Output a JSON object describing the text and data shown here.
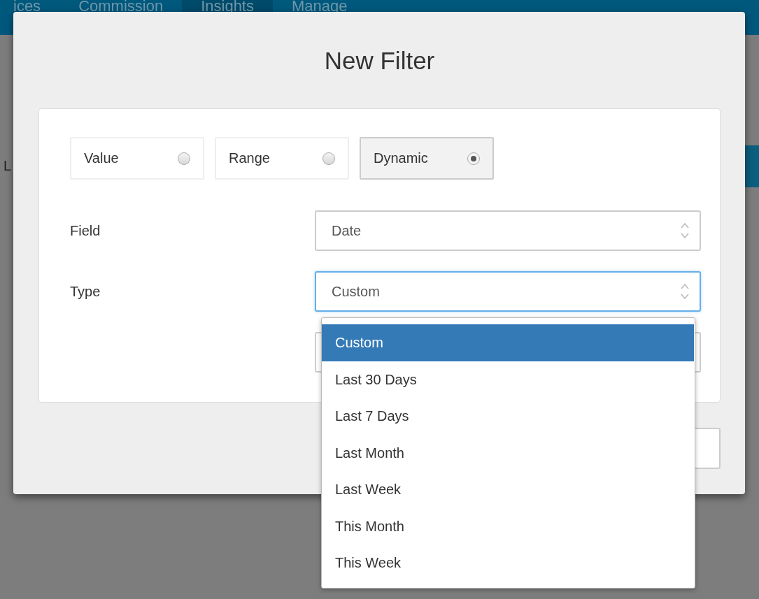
{
  "nav": [
    {
      "label": "ices",
      "selected": false
    },
    {
      "label": "Commission",
      "selected": false
    },
    {
      "label": "Insights",
      "selected": true
    },
    {
      "label": "Manage",
      "selected": false
    }
  ],
  "background": {
    "row_label": "L"
  },
  "dialog": {
    "title": "New Filter",
    "modes": [
      {
        "label": "Value",
        "selected": false
      },
      {
        "label": "Range",
        "selected": false
      },
      {
        "label": "Dynamic",
        "selected": true
      }
    ],
    "fields": [
      {
        "label": "Field",
        "value": "Date",
        "focused": false
      },
      {
        "label": "Type",
        "value": "Custom",
        "focused": true
      }
    ],
    "dropdown": {
      "options": [
        {
          "label": "Custom",
          "selected": true
        },
        {
          "label": "Last 30 Days",
          "selected": false
        },
        {
          "label": "Last 7 Days",
          "selected": false
        },
        {
          "label": "Last Month",
          "selected": false
        },
        {
          "label": "Last Week",
          "selected": false
        },
        {
          "label": "This Month",
          "selected": false
        },
        {
          "label": "This Week",
          "selected": false
        }
      ]
    }
  }
}
